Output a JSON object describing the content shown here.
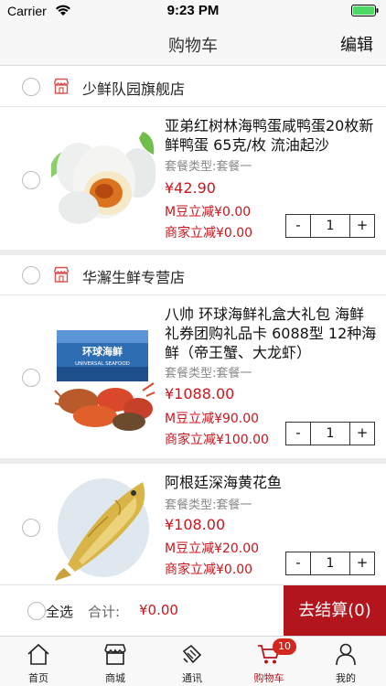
{
  "status_bar": {
    "carrier": "Carrier",
    "time": "9:23 PM"
  },
  "nav": {
    "title": "购物车",
    "edit_label": "编辑"
  },
  "shops": [
    {
      "name": "少鲜队园旗舰店",
      "items": [
        {
          "name": "亚弟红树林海鸭蛋咸鸭蛋20枚新鲜鸭蛋 65克/枚 流油起沙",
          "package": "套餐类型:套餐一",
          "price": "¥42.90",
          "m_discount": "M豆立减¥0.00",
          "shop_discount": "商家立减¥0.00",
          "quantity": "1"
        }
      ]
    },
    {
      "name": "华澥生鲜专营店",
      "items": [
        {
          "name": "八帅 环球海鲜礼盒大礼包 海鲜礼券团购礼品卡 6088型 12种海鲜（帝王蟹、大龙虾）",
          "package": "套餐类型:套餐一",
          "price": "¥1088.00",
          "m_discount": "M豆立减¥90.00",
          "shop_discount": "商家立减¥100.00",
          "quantity": "1",
          "box_title": "环球海鲜",
          "box_subtitle": "UNIVERSAL SEAFOOD"
        },
        {
          "name": "阿根廷深海黄花鱼",
          "package": "套餐类型:套餐一",
          "price": "¥108.00",
          "m_discount": "M豆立减¥20.00",
          "shop_discount": "商家立减¥0.00",
          "quantity": "1"
        }
      ]
    }
  ],
  "stepper": {
    "minus": "-",
    "plus": "+"
  },
  "checkout": {
    "select_all": "全选",
    "total_label": "合计:",
    "total_value": "¥0.00",
    "button_label": "去结算(0)"
  },
  "tabs": [
    {
      "label": "首页",
      "icon": "home-icon"
    },
    {
      "label": "商城",
      "icon": "store-icon"
    },
    {
      "label": "通讯",
      "icon": "communication-icon"
    },
    {
      "label": "购物车",
      "icon": "cart-icon",
      "badge": "10",
      "active": true
    },
    {
      "label": "我的",
      "icon": "person-icon"
    }
  ],
  "colors": {
    "accent": "#b3151c",
    "price": "#c8161d",
    "badge": "#d3271f"
  }
}
